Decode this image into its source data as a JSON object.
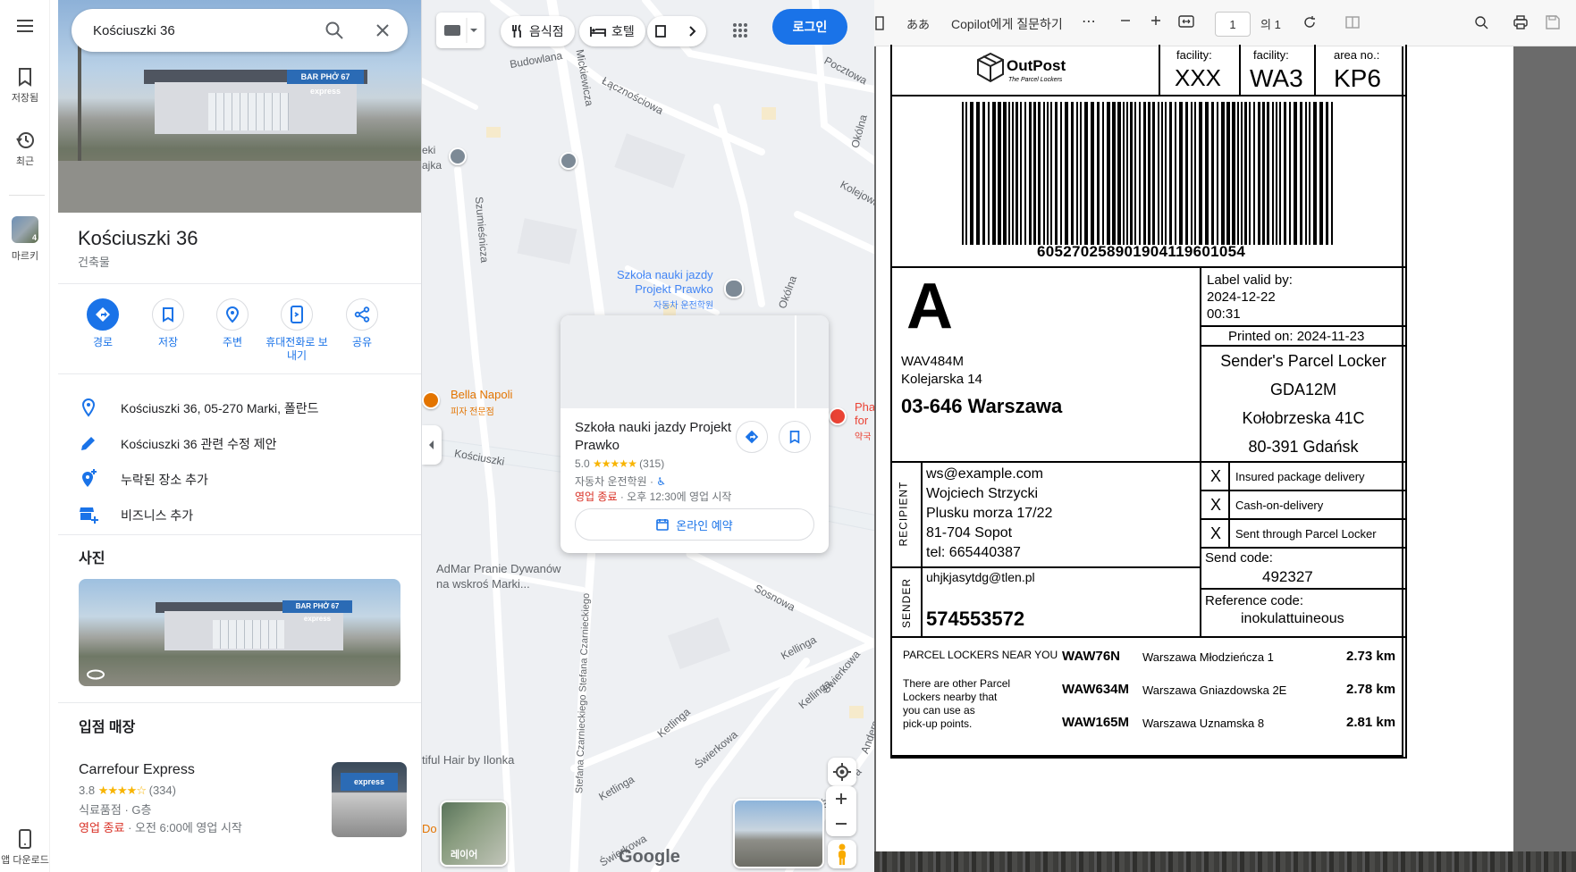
{
  "rail": {
    "saved": "저장됨",
    "recent": "최근",
    "place": "마르키",
    "place_badge": "4",
    "app": "앱 다운로드"
  },
  "search": {
    "value": "Kościuszki 36"
  },
  "hero": {
    "sign_text": "BAR PHỞ 67  express"
  },
  "place": {
    "title": "Kościuszki 36",
    "subtitle": "건축물"
  },
  "actions": [
    {
      "label": "경로"
    },
    {
      "label": "저장"
    },
    {
      "label": "주변"
    },
    {
      "label": "휴대전화로 보내기"
    },
    {
      "label": "공유"
    }
  ],
  "info": {
    "address": "Kościuszki 36, 05-270 Marki, 폴란드",
    "suggest_edit": "Kościuszki 36 관련 수정 제안",
    "add_missing": "누락된 장소 추가",
    "add_business": "비즈니스 추가"
  },
  "photos": {
    "heading": "사진"
  },
  "stores": {
    "heading": "입점 매장",
    "items": [
      {
        "name": "Carrefour Express",
        "rating": "3.8",
        "stars": "★★★★☆",
        "reviews": "(334)",
        "category": "식료품점 · G층",
        "status_closed": "영업 종료",
        "status_rest": " · 오전 6:00에 영업 시작"
      }
    ]
  },
  "map": {
    "chips": [
      "음식점",
      "호텔"
    ],
    "login": "로그인",
    "street_labels": [
      "Budowlana",
      "Mickiewicza",
      "Łącznościowa",
      "Pocztowa",
      "Okólna",
      "Kolejowa",
      "Szumieśnicza",
      "Okólna",
      "Kościuszki",
      "Sosnowa",
      "Kellinga",
      "Świerkowa",
      "Ketlinga",
      "Świerkowa",
      "Stefana Czarnieckiego Stefana Czarnieckiego",
      "Kellinga",
      "Świerkowa",
      "Andersa",
      "Ketlinga",
      "Świerkowa",
      "Kościuszki"
    ],
    "pois": {
      "school_name": "Szkoła nauki jazdy\nProjekt Prawko",
      "school_cat": "자동차 운전학원",
      "pizza_name": "Bella Napoli",
      "pizza_cat": "피자 전문점",
      "pharmacy_name": "Pha\nfor",
      "pharmacy_cat": "약국",
      "rug_name": "AdMar Pranie Dywanów\nna wskroś Marki...",
      "hair_name": "tiful Hair by Ilonka",
      "edge_name": "eki\najka",
      "edge2": "Do"
    },
    "card": {
      "title": "Szkoła nauki jazdy Projekt Prawko",
      "rating": "5.0",
      "stars": "★★★★★",
      "reviews": "(315)",
      "category": "자동차 운전학원 · ",
      "status_closed": "영업 종료",
      "status_rest": " · 오후 12:30에 영업 시작",
      "book": "온라인 예약"
    },
    "layers": "레이어",
    "logo": "Google"
  },
  "pdf": {
    "ask_copilot": "Copilot에게 질문하기",
    "page_value": "1",
    "page_total": "의 1",
    "read_aloud": "ああ",
    "colors": {
      "accent": "#1a73e8",
      "closed": "#d93025",
      "star": "#f8b400",
      "poi_blue": "#4285f4",
      "food": "#e37400",
      "pharmacy": "#ea4335"
    }
  },
  "label": {
    "brand": "OutPost",
    "brand_tag": "The Parcel Lockers",
    "facility1_head": "facility:",
    "facility1_val": "XXX",
    "facility2_head": "facility:",
    "facility2_val": "WA3",
    "area_head": "area no.:",
    "area_val": "KP6",
    "barcode_number": "605270258901904119601054",
    "size_letter": "A",
    "dest_code": "WAV484M",
    "dest_street": "Kolejarska 14",
    "dest_city": "03-646 Warszawa",
    "valid_by_label": "Label valid by:",
    "valid_by_date": "2024-12-22",
    "valid_by_time": "00:31",
    "printed_on": "Printed on: 2024-11-23",
    "sender_locker_head": "Sender's Parcel Locker",
    "sender_locker_code": "GDA12M",
    "sender_locker_street": "Kołobrzeska 41C",
    "sender_locker_city": "80-391 Gdańsk",
    "recipient_label": "RECIPIENT",
    "recipient_email": "ws@example.com",
    "recipient_name": "Wojciech Strzycki",
    "recipient_street": "Plusku morza 17/22",
    "recipient_city": "81-704 Sopot",
    "recipient_tel": "tel: 665440387",
    "checks": [
      {
        "mark": "X",
        "text": "Insured package delivery"
      },
      {
        "mark": "X",
        "text": "Cash-on-delivery"
      },
      {
        "mark": "X",
        "text": "Sent through Parcel Locker"
      }
    ],
    "sender_label": "SENDER",
    "sender_email": "uhjkjasytdg@tlen.pl",
    "sender_phone": "574553572",
    "send_code_label": "Send code:",
    "send_code": "492327",
    "ref_code_label": "Reference code:",
    "ref_code": "inokulattuineous",
    "nearby_head": "PARCEL LOCKERS NEAR YOU",
    "nearby_note": "There are other Parcel\nLockers nearby that\nyou can use as\npick-up points.",
    "nearby": [
      {
        "code": "WAW76N",
        "addr": "Warszawa Młodzieńcza 1",
        "dist": "2.73 km"
      },
      {
        "code": "WAW634M",
        "addr": "Warszawa Gniazdowska 2E",
        "dist": "2.78 km"
      },
      {
        "code": "WAW165M",
        "addr": "Warszawa Uznamska 8",
        "dist": "2.81 km"
      }
    ]
  }
}
